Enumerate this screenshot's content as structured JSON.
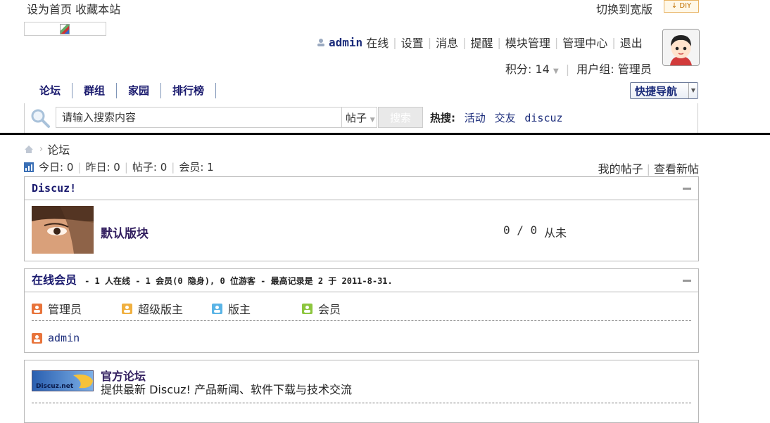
{
  "top": {
    "set_home": "设为首页",
    "bookmark": "收藏本站",
    "switch_wide": "切换到宽版",
    "diy_label": "DIY"
  },
  "user": {
    "username": "admin",
    "status": "在线",
    "links": [
      "设置",
      "消息",
      "提醒",
      "模块管理",
      "管理中心",
      "退出"
    ],
    "credits_label": "积分: 14",
    "group_label": "用户组: 管理员"
  },
  "nav": {
    "items": [
      "论坛",
      "群组",
      "家园",
      "排行榜"
    ],
    "quick_nav": "快捷导航"
  },
  "search": {
    "placeholder": "请输入搜索内容",
    "type": "帖子",
    "button": "搜索",
    "hot_label": "热搜:",
    "hot_keywords": [
      "活动",
      "交友",
      "discuz"
    ]
  },
  "breadcrumb": {
    "current": "论坛"
  },
  "stats": {
    "today": "今日: 0",
    "yesterday": "昨日: 0",
    "posts": "帖子: 0",
    "members": "会员: 1",
    "my_posts": "我的帖子",
    "new_posts": "查看新帖"
  },
  "category": {
    "title": "Discuz!",
    "forum": {
      "name": "默认版块",
      "stats": "0 / 0",
      "last_post": "从未"
    }
  },
  "online": {
    "title": "在线会员",
    "info": "- 1 人在线 - 1 会员(0 隐身), 0 位游客 - 最高记录是 2 于 2011-8-31.",
    "legend": [
      "管理员",
      "超级版主",
      "版主",
      "会员"
    ],
    "users": [
      "admin"
    ]
  },
  "links": {
    "title": "官方论坛",
    "description": "提供最新 Discuz! 产品新闻、软件下载与技术交流",
    "logo_text": "Discuz.net"
  },
  "colors": {
    "admin_icon": "#e8743b",
    "super_mod_icon": "#f0b040",
    "mod_icon": "#5ab4e6",
    "member_icon": "#8dc63f"
  }
}
